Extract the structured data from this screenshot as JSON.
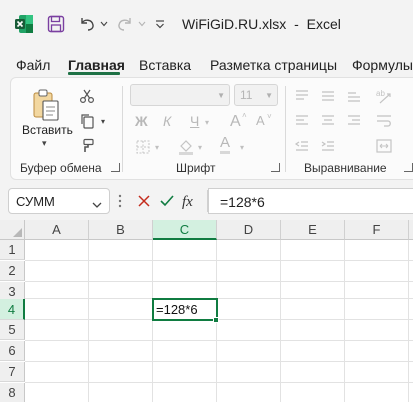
{
  "title_bar": {
    "document_title": "WiFiGiD.RU.xlsx",
    "separator": "-",
    "app_name": "Excel",
    "icons": [
      "excel-logo-icon",
      "save-icon",
      "undo-icon",
      "redo-icon",
      "customize-qat-icon"
    ]
  },
  "menu": {
    "tabs": [
      {
        "label": "Файл",
        "active": false
      },
      {
        "label": "Главная",
        "active": true
      },
      {
        "label": "Вставка",
        "active": false
      },
      {
        "label": "Разметка страницы",
        "active": false
      },
      {
        "label": "Формулы",
        "active": false
      }
    ]
  },
  "ribbon": {
    "clipboard": {
      "paste_label": "Вставить",
      "group_label": "Буфер обмена"
    },
    "font": {
      "font_name": "",
      "font_size": "11",
      "bold": "Ж",
      "italic": "К",
      "underline": "Ч",
      "grow": "A",
      "shrink": "A",
      "font_color_letter": "A",
      "group_label": "Шрифт"
    },
    "alignment": {
      "group_label": "Выравнивание"
    }
  },
  "formula_bar": {
    "name_box": "СУММ",
    "formula": "=128*6"
  },
  "sheet": {
    "columns": [
      "A",
      "B",
      "C",
      "D",
      "E",
      "F"
    ],
    "rows": [
      "1",
      "2",
      "3",
      "4",
      "5",
      "6",
      "7",
      "8"
    ],
    "selected_column": "C",
    "selected_row": "4",
    "active_cell": {
      "ref": "C4",
      "content": "=128*6"
    }
  },
  "colors": {
    "accent": "#107c41",
    "excel_green": "#1e7145",
    "chrome_bg": "#f3f3f3",
    "cancel_red": "#c42b1c"
  }
}
